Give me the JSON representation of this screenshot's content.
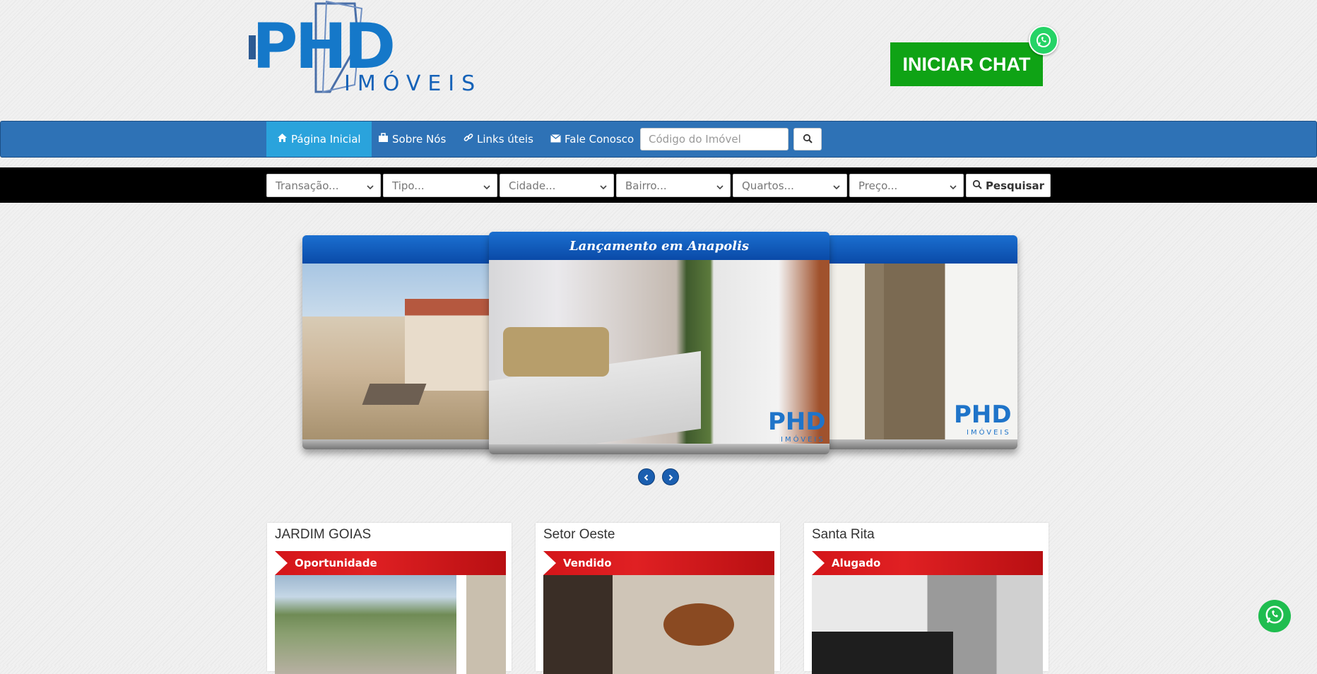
{
  "header": {
    "logo_text": "PHD",
    "logo_subtext": "IMÓVEIS",
    "chat_label": "INICIAR CHAT",
    "whatsapp_icon": "whatsapp-icon"
  },
  "nav": {
    "items": [
      {
        "label": "Página Inicial",
        "icon": "home-icon"
      },
      {
        "label": "Sobre Nós",
        "icon": "briefcase-icon"
      },
      {
        "label": "Links úteis",
        "icon": "link-icon"
      },
      {
        "label": "Fale Conosco",
        "icon": "envelope-icon"
      }
    ],
    "code_placeholder": "Código do Imóvel"
  },
  "filters": {
    "selects": [
      "Transação...",
      "Tipo...",
      "Cidade...",
      "Bairro...",
      "Quartos...",
      "Preço..."
    ],
    "search_label": "Pesquisar"
  },
  "carousel": {
    "center_title": "Lançamento em Anapolis"
  },
  "cards": [
    {
      "title": "JARDIM GOIAS",
      "ribbon": "Oportunidade"
    },
    {
      "title": "Setor Oeste",
      "ribbon": "Vendido"
    },
    {
      "title": "Santa Rita",
      "ribbon": "Alugado"
    }
  ],
  "colors": {
    "nav_blue": "#2e72b6",
    "nav_active": "#2aa3dc",
    "chat_green": "#0fa315",
    "ribbon_red": "#d41519",
    "slide_blue": "#0a4aa8"
  }
}
